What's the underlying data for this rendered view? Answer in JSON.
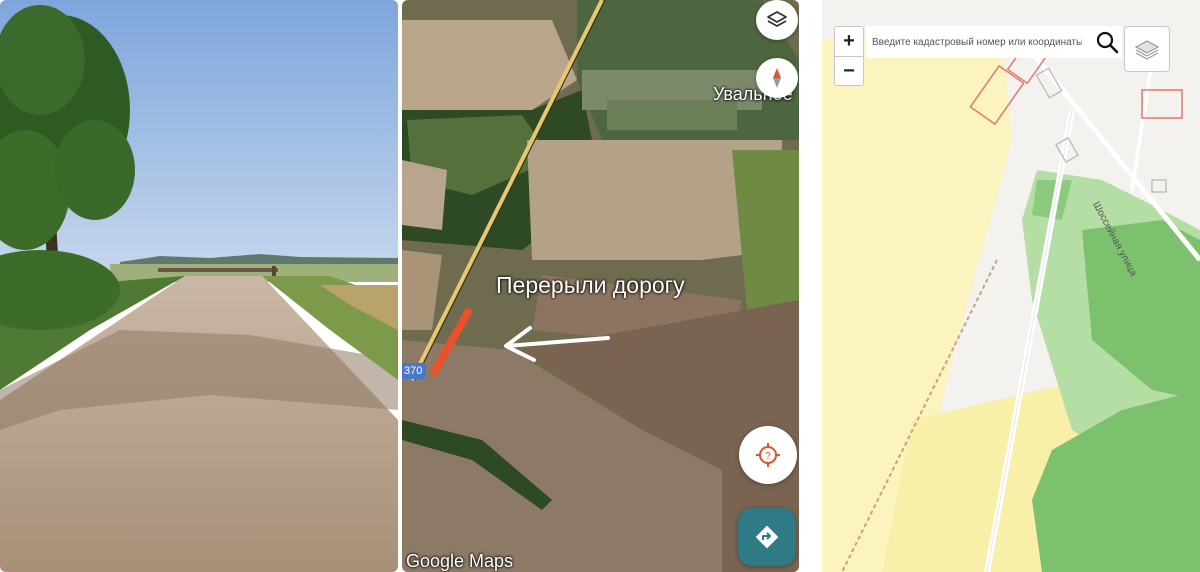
{
  "photo_panel": {
    "sky_color": "#8fb4e2",
    "road_color": "#b5a08a",
    "foliage_color": "#3c6b2a"
  },
  "satellite_panel": {
    "place_label": "Увальное",
    "annotation_text": "Перерыли дорогу",
    "route_number": "370",
    "attribution": "Google Maps",
    "marker_color": "#e8502e",
    "buttons": {
      "layers_icon": "layers-icon",
      "compass_icon": "compass-icon",
      "location_icon": "my-location-icon",
      "directions_icon": "directions-icon"
    }
  },
  "cadastral_panel": {
    "zoom_in_label": "+",
    "zoom_out_label": "−",
    "search_placeholder": "Введите кадастровый номер или координаты",
    "street_label": "Шоссейная улица",
    "colors": {
      "forest": "#7cc26e",
      "light_forest": "#b5dea5",
      "zone_yellow": "#fbf4bf",
      "parcel_outline": "#e07b6b"
    }
  }
}
